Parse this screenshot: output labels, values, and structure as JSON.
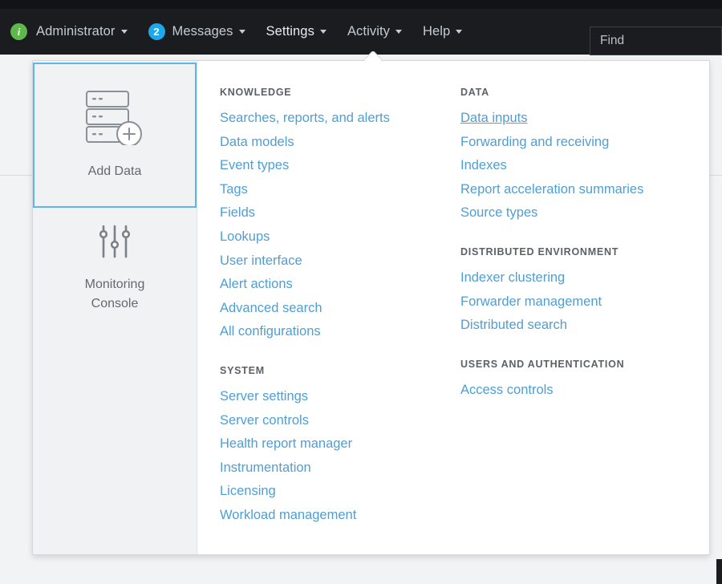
{
  "topbar": {
    "info_icon": "info-circle-icon",
    "user": {
      "label": "Administrator",
      "caret": "chevron-down-icon"
    },
    "messages": {
      "badge": "2",
      "label": "Messages",
      "caret": "chevron-down-icon"
    },
    "settings": {
      "label": "Settings",
      "caret": "chevron-down-icon"
    },
    "activity": {
      "label": "Activity",
      "caret": "chevron-down-icon"
    },
    "help": {
      "label": "Help",
      "caret": "chevron-down-icon"
    },
    "find": {
      "value": "",
      "placeholder": "Find",
      "icon": "search-icon"
    },
    "background_color": "#1a1c20",
    "text_color": "#c3cbd4",
    "info_badge_color": "#5dba4a",
    "message_badge_color": "#1ca9ec"
  },
  "dropdown": {
    "rail": {
      "tiles": [
        {
          "label": "Add Data",
          "icon": "server-stack-add-icon",
          "selected": true
        },
        {
          "label": "Monitoring\nConsole",
          "icon": "sliders-icon",
          "selected": false
        }
      ],
      "selected_border_color": "#5fb4e8",
      "background_color": "#f1f2f3"
    },
    "link_color": "#4f9ed4",
    "group_title_color": "#5c6166",
    "columns": [
      {
        "groups": [
          {
            "title": "KNOWLEDGE",
            "links": [
              {
                "label": "Searches, reports, and alerts",
                "hovered": false
              },
              {
                "label": "Data models",
                "hovered": false
              },
              {
                "label": "Event types",
                "hovered": false
              },
              {
                "label": "Tags",
                "hovered": false
              },
              {
                "label": "Fields",
                "hovered": false
              },
              {
                "label": "Lookups",
                "hovered": false
              },
              {
                "label": "User interface",
                "hovered": false
              },
              {
                "label": "Alert actions",
                "hovered": false
              },
              {
                "label": "Advanced search",
                "hovered": false
              },
              {
                "label": "All configurations",
                "hovered": false
              }
            ]
          },
          {
            "title": "SYSTEM",
            "links": [
              {
                "label": "Server settings",
                "hovered": false
              },
              {
                "label": "Server controls",
                "hovered": false
              },
              {
                "label": "Health report manager",
                "hovered": false
              },
              {
                "label": "Instrumentation",
                "hovered": false
              },
              {
                "label": "Licensing",
                "hovered": false
              },
              {
                "label": "Workload management",
                "hovered": false
              }
            ]
          }
        ]
      },
      {
        "groups": [
          {
            "title": "DATA",
            "links": [
              {
                "label": "Data inputs",
                "hovered": true
              },
              {
                "label": "Forwarding and receiving",
                "hovered": false
              },
              {
                "label": "Indexes",
                "hovered": false
              },
              {
                "label": "Report acceleration summaries",
                "hovered": false
              },
              {
                "label": "Source types",
                "hovered": false
              }
            ]
          },
          {
            "title": "DISTRIBUTED ENVIRONMENT",
            "links": [
              {
                "label": "Indexer clustering",
                "hovered": false
              },
              {
                "label": "Forwarder management",
                "hovered": false
              },
              {
                "label": "Distributed search",
                "hovered": false
              }
            ]
          },
          {
            "title": "USERS AND AUTHENTICATION",
            "links": [
              {
                "label": "Access controls",
                "hovered": false
              }
            ]
          }
        ]
      }
    ]
  }
}
